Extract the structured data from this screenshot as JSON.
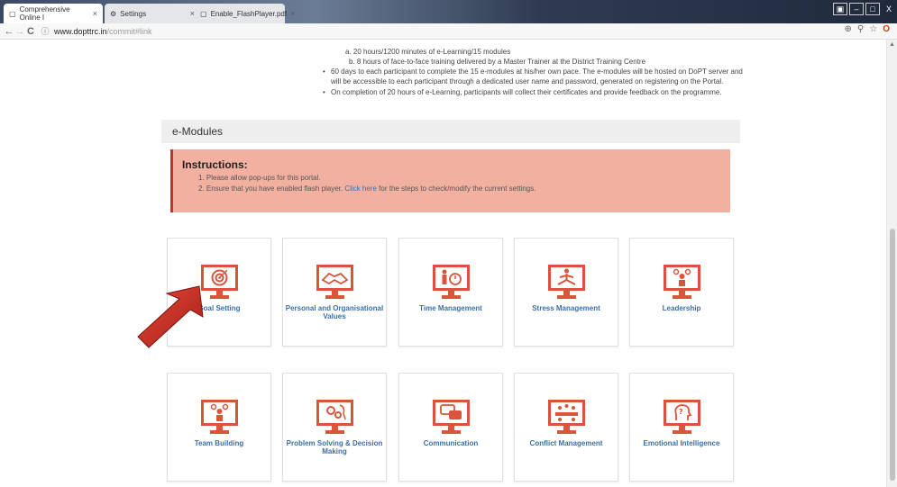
{
  "browser": {
    "tabs": [
      {
        "title": "Comprehensive Online I",
        "close": "×"
      },
      {
        "title": "Settings",
        "close": "×"
      },
      {
        "title": "Enable_FlashPlayer.pdf",
        "close": "×"
      }
    ],
    "window_controls": [
      "▣",
      "–",
      "□",
      "X"
    ],
    "url_host": "www.dopttrc.in",
    "url_path": "/commit#link",
    "icons": [
      "back-icon",
      "forward-icon",
      "reload-icon",
      "info-icon",
      "zoom-icon",
      "filter-icon",
      "star-icon",
      "opera-icon"
    ]
  },
  "info": {
    "line_a": "a. 20 hours/1200 minutes of e-Learning/15 modules",
    "line_b": "b. 8 hours of face-to-face training delivered by a Master Trainer at the District Training Centre",
    "bullet1_line1": "60 days to each participant to complete the 15 e-modules at his/her own pace. The e-modules will be hosted on DoPT server and",
    "bullet1_line2": "will be accessible to each participant through a dedicated user name and password, generated on registering on the Portal.",
    "bullet2": "On completion of 20 hours of e-Learning, participants will collect their certificates and provide feedback on the programme."
  },
  "section": {
    "title": "e-Modules"
  },
  "instructions": {
    "title": "Instructions:",
    "line1": "1. Please allow pop-ups for this portal.",
    "line2_before": "2. Ensure that you have enabled flash player.",
    "line2_link": "Click here",
    "line2_after": "for the steps to check/modify the current settings."
  },
  "modules": [
    {
      "label": "Goal Setting",
      "icon": "target-icon"
    },
    {
      "label": "Personal and Organisational Values",
      "icon": "handshake-icon"
    },
    {
      "label": "Time Management",
      "icon": "clock-person-icon"
    },
    {
      "label": "Stress Management",
      "icon": "meditation-icon"
    },
    {
      "label": "Leadership",
      "icon": "leader-group-icon"
    },
    {
      "label": "Team Building",
      "icon": "team-icon"
    },
    {
      "label": "Problem Solving & Decision Making",
      "icon": "gears-head-icon"
    },
    {
      "label": "Communication",
      "icon": "speech-bubbles-icon"
    },
    {
      "label": "Conflict Management",
      "icon": "meeting-icon"
    },
    {
      "label": "Emotional Intelligence",
      "icon": "head-question-icon"
    }
  ],
  "colors": {
    "accent_red": "#d9543b",
    "link_blue": "#3b6fa8",
    "instruction_bg": "#f2b0a0",
    "arrow_red": "#c42a1e"
  }
}
